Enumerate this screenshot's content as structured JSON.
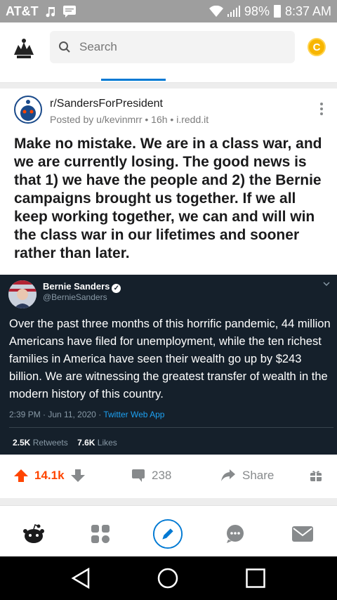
{
  "status_bar": {
    "carrier": "AT&T",
    "battery": "98%",
    "time": "8:37 AM"
  },
  "header": {
    "search_placeholder": "Search",
    "coin_label": "C"
  },
  "post": {
    "subreddit": "r/SandersForPresident",
    "meta": "Posted by u/kevinmrr • 16h • i.redd.it",
    "title": "Make no mistake. We are in a class war, and we are currently losing. The good news is that 1) we have the people and 2) the Bernie campaigns brought us together. If we all keep working together, we can and will win the class war in our lifetimes and sooner rather than later."
  },
  "tweet": {
    "name": "Bernie Sanders",
    "verified_mark": "✓",
    "handle": "@BernieSanders",
    "text": "Over the past three months of this horrific pandemic, 44 million Americans have filed for unemployment, while the ten richest families in America have seen their wealth go up by $243 billion. We are witnessing the greatest transfer of wealth in the modern history of this country.",
    "time": "2:39 PM · Jun 11, 2020 · ",
    "app": "Twitter Web App",
    "retweets_count": "2.5K",
    "retweets_label": "Retweets",
    "likes_count": "7.6K",
    "likes_label": "Likes"
  },
  "actions": {
    "votes": "14.1k",
    "comments": "238",
    "share": "Share"
  },
  "colors": {
    "upvote": "#ff4500",
    "accent": "#0079d3",
    "tweet_bg": "#15202b"
  }
}
